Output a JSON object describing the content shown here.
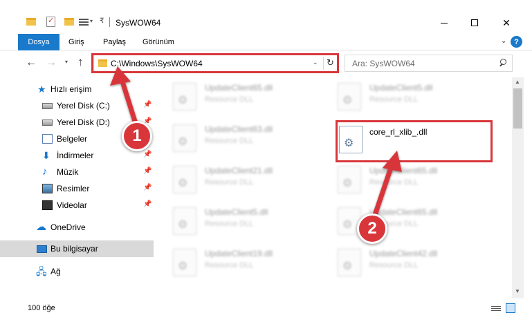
{
  "window": {
    "title": "SysWOW64",
    "icons": [
      "folder-icon",
      "properties-icon",
      "new-folder-icon",
      "view-icon"
    ]
  },
  "ribbon": {
    "file_tab": "Dosya",
    "tabs": [
      "Giriş",
      "Paylaş",
      "Görünüm"
    ]
  },
  "address": {
    "path": "C:\\Windows\\SysWOW64",
    "search_placeholder": "Ara: SysWOW64"
  },
  "nav": {
    "quick_access": "Hızlı erişim",
    "items": [
      {
        "label": "Yerel Disk (C:)",
        "icon": "hard-disk-icon"
      },
      {
        "label": "Yerel Disk (D:)",
        "icon": "hard-disk-icon"
      },
      {
        "label": "Belgeler",
        "icon": "documents-icon"
      },
      {
        "label": "İndirmeler",
        "icon": "downloads-icon"
      },
      {
        "label": "Müzik",
        "icon": "music-icon"
      },
      {
        "label": "Resimler",
        "icon": "pictures-icon"
      },
      {
        "label": "Videolar",
        "icon": "videos-icon"
      }
    ],
    "onedrive": "OneDrive",
    "this_pc": "Bu bilgisayar",
    "network": "Ağ"
  },
  "files": [
    {
      "name": "UpdateClient65.dll",
      "type": "Resource DLL"
    },
    {
      "name": "UpdateClient5.dll",
      "type": "Resource DLL"
    },
    {
      "name": "UpdateClient63.dll",
      "type": "Resource DLL"
    },
    {
      "name": "core_rl_xlib_.dll",
      "type": ""
    },
    {
      "name": "UpdateClient21.dll",
      "type": "Resource DLL"
    },
    {
      "name": "UpdateClient65.dll",
      "type": "Resource DLL"
    },
    {
      "name": "UpdateClient5.dll",
      "type": "Resource DLL"
    },
    {
      "name": "UpdateClient65.dll",
      "type": "Resource DLL"
    },
    {
      "name": "UpdateClient19.dll",
      "type": "Resource DLL"
    },
    {
      "name": "UpdateClient42.dll",
      "type": "Resource DLL"
    }
  ],
  "status": {
    "item_count": "100 öğe"
  },
  "annotations": {
    "step1": "1",
    "step2": "2",
    "highlight_color": "#d8363a"
  },
  "colors": {
    "accent": "#1979ca",
    "selection": "#d9d9d9"
  }
}
